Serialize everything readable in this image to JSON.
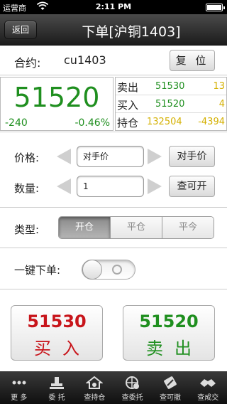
{
  "status_bar": {
    "carrier": "运营商",
    "time": "2:11 PM"
  },
  "nav": {
    "back_label": "返回",
    "title": "下单[沪铜1403]"
  },
  "contract": {
    "label": "合约:",
    "code": "cu1403",
    "reset_label": "复 位"
  },
  "quote": {
    "last_price": "51520",
    "change": "-240",
    "change_pct": "-0.46%",
    "ask": {
      "label": "卖出",
      "price": "51530",
      "volume": "13"
    },
    "bid": {
      "label": "买入",
      "price": "51520",
      "volume": "4"
    },
    "open_interest": {
      "label": "持仓",
      "value": "132504",
      "change": "-4394"
    }
  },
  "order": {
    "price_label": "价格:",
    "price_value": "对手价",
    "price_button": "对手价",
    "qty_label": "数量:",
    "qty_value": "1",
    "qty_button": "查可开"
  },
  "type": {
    "label": "类型:",
    "options": [
      "开仓",
      "平仓",
      "平今"
    ],
    "selected": "开仓"
  },
  "quick_order": {
    "label": "一键下单:",
    "enabled": false
  },
  "trade": {
    "buy": {
      "price": "51530",
      "label": "买入"
    },
    "sell": {
      "price": "51520",
      "label": "卖出"
    }
  },
  "tabs": [
    {
      "label": "更 多",
      "icon": "more-icon"
    },
    {
      "label": "委 托",
      "icon": "order-icon"
    },
    {
      "label": "查持仓",
      "icon": "position-icon"
    },
    {
      "label": "查委托",
      "icon": "query-order-icon"
    },
    {
      "label": "查可撤",
      "icon": "cancel-icon"
    },
    {
      "label": "查成交",
      "icon": "deal-icon"
    }
  ],
  "colors": {
    "up": "#c8151b",
    "down": "#1f8f1f",
    "volume": "#d4b000"
  }
}
